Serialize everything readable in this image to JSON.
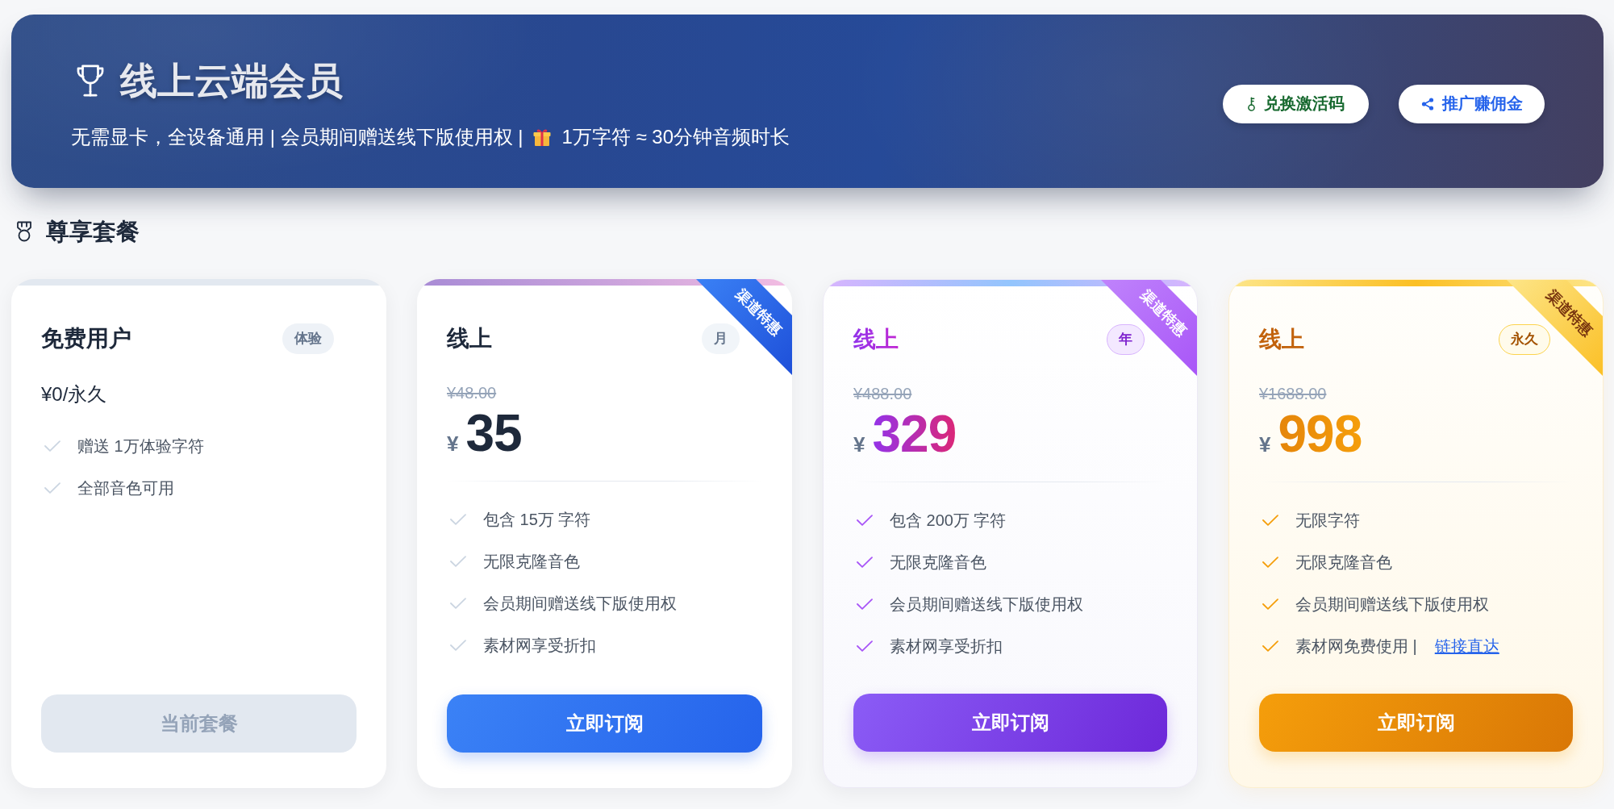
{
  "header": {
    "title": "线上云端会员",
    "subtitle": "无需显卡，全设备通用 | 会员期间赠送线下版使用权 |",
    "note": "1万字符 ≈ 30分钟音频时长",
    "actions": [
      {
        "label": "兑换激活码",
        "kind": "redeem"
      },
      {
        "label": "推广赚佣金",
        "kind": "share"
      }
    ]
  },
  "section": {
    "title": "尊享套餐"
  },
  "plans": [
    {
      "kind": "basic",
      "title": "免费用户",
      "badge": "体验",
      "price_text": "¥0/永久",
      "features": [
        {
          "text": "赠送 1万体验字符"
        },
        {
          "text": "全部音色可用"
        }
      ],
      "button": {
        "label": "当前套餐",
        "disabled": true
      }
    },
    {
      "kind": "blue",
      "ribbon": "渠道特惠",
      "title": "线上",
      "badge": "月",
      "original_price": "¥48.00",
      "currency": "¥",
      "price": "35",
      "features": [
        {
          "text": "包含 15万 字符"
        },
        {
          "text": "无限克隆音色"
        },
        {
          "text": "会员期间赠送线下版使用权"
        },
        {
          "text": "素材网享受折扣"
        }
      ],
      "button": {
        "label": "立即订阅",
        "disabled": false
      }
    },
    {
      "kind": "violet",
      "ribbon": "渠道特惠",
      "title": "线上",
      "badge": "年",
      "original_price": "¥488.00",
      "currency": "¥",
      "price": "329",
      "features": [
        {
          "text": "包含 200万 字符"
        },
        {
          "text": "无限克隆音色"
        },
        {
          "text": "会员期间赠送线下版使用权"
        },
        {
          "text": "素材网享受折扣"
        }
      ],
      "button": {
        "label": "立即订阅",
        "disabled": false
      }
    },
    {
      "kind": "amber",
      "ribbon": "渠道特惠",
      "title": "线上",
      "badge": "永久",
      "original_price": "¥1688.00",
      "currency": "¥",
      "price": "998",
      "features": [
        {
          "text": "无限字符"
        },
        {
          "text": "无限克隆音色"
        },
        {
          "text": "会员期间赠送线下版使用权"
        },
        {
          "text": "素材网免费使用 |",
          "link": "链接直达"
        }
      ],
      "button": {
        "label": "立即订阅",
        "disabled": false
      }
    }
  ]
}
